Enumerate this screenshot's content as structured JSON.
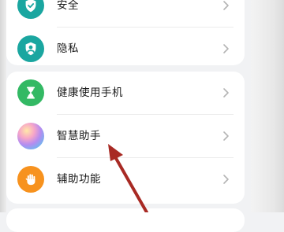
{
  "settings_group_1": {
    "items": [
      {
        "label": "安全",
        "icon": "shield-check-icon",
        "icon_color": "#1aa6a0"
      },
      {
        "label": "隐私",
        "icon": "privacy-user-icon",
        "icon_color": "#1aa6a0"
      }
    ]
  },
  "settings_group_2": {
    "items": [
      {
        "label": "健康使用手机",
        "icon": "hourglass-icon",
        "icon_color": "#33b964"
      },
      {
        "label": "智慧助手",
        "icon": "assistant-orb-icon",
        "icon_color": "#c48de0"
      },
      {
        "label": "辅助功能",
        "icon": "hand-icon",
        "icon_color": "#f7921e"
      }
    ]
  },
  "annotation": {
    "arrow_color": "#a82a24"
  }
}
